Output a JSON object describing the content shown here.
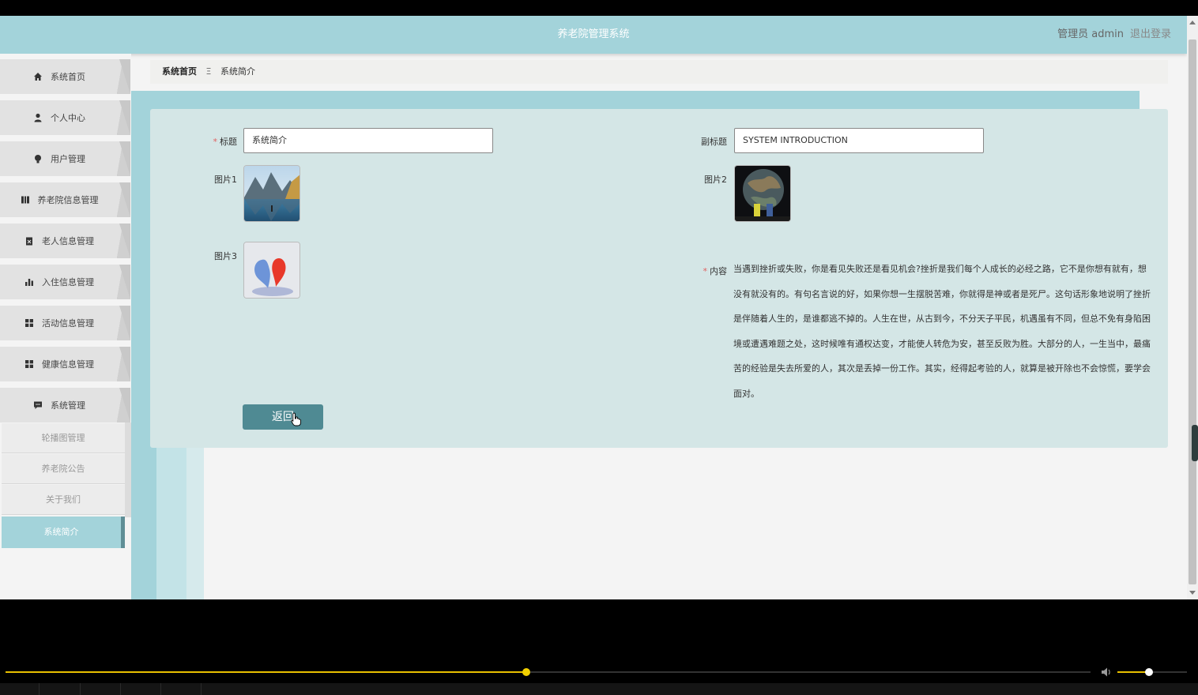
{
  "header": {
    "title": "养老院管理系统",
    "user": "管理员 admin",
    "logout": "退出登录"
  },
  "sidebar": {
    "items": [
      {
        "label": "系统首页",
        "icon": "home-icon"
      },
      {
        "label": "个人中心",
        "icon": "user-icon"
      },
      {
        "label": "用户管理",
        "icon": "bulb-icon"
      },
      {
        "label": "养老院信息管理",
        "icon": "book-icon"
      },
      {
        "label": "老人信息管理",
        "icon": "clipboard-icon"
      },
      {
        "label": "入住信息管理",
        "icon": "bar-chart-icon"
      },
      {
        "label": "活动信息管理",
        "icon": "grid-icon"
      },
      {
        "label": "健康信息管理",
        "icon": "grid-icon"
      },
      {
        "label": "系统管理",
        "icon": "chat-icon"
      }
    ],
    "sub_items": [
      {
        "label": "轮播图管理",
        "active": false
      },
      {
        "label": "养老院公告",
        "active": false
      },
      {
        "label": "关于我们",
        "active": false
      },
      {
        "label": "系统简介",
        "active": true
      }
    ]
  },
  "breadcrumb": {
    "home": "系统首页",
    "sep": "Ξ",
    "current": "系统简介"
  },
  "form": {
    "title_label": "标题",
    "title_value": "系统简介",
    "subtitle_label": "副标题",
    "subtitle_value": "SYSTEM INTRODUCTION",
    "pic1_label": "图片1",
    "pic2_label": "图片2",
    "pic3_label": "图片3",
    "content_label": "内容",
    "content_value": "当遇到挫折或失败，你是看见失败还是看见机会?挫折是我们每个人成长的必经之路，它不是你想有就有，想没有就没有的。有句名言说的好，如果你想一生摆脱苦难，你就得是神或者是死尸。这句话形象地说明了挫折是伴随着人生的，是谁都逃不掉的。人生在世，从古到今，不分天子平民，机遇虽有不同，但总不免有身陷困境或遭遇难题之处，这时候唯有通权达变，才能使人转危为安，甚至反败为胜。大部分的人，一生当中，最痛苦的经验是失去所爱的人，其次是丢掉一份工作。其实，经得起考验的人，就算是被开除也不会惊慌，要学会面对。",
    "back_button": "返回"
  },
  "player": {
    "progress_fraction": 0.48,
    "volume_fraction": 0.45,
    "accent_color": "#e8c000"
  },
  "colors": {
    "header_bg": "#a3d3da",
    "panel_bg": "#d4e6e6",
    "button_bg": "#4f8a93"
  }
}
